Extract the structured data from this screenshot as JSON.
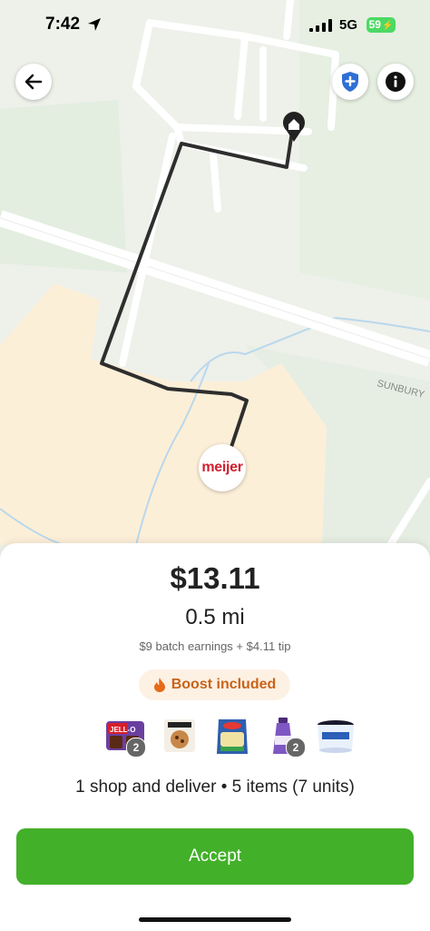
{
  "status_bar": {
    "time": "7:42",
    "network": "5G",
    "battery": "59"
  },
  "map": {
    "store_name": "meijer",
    "road_label": "SUNBURY"
  },
  "offer": {
    "price": "$13.11",
    "distance": "0.5 mi",
    "breakdown": "$9 batch earnings + $4.11 tip",
    "boost_label": "Boost included",
    "items": [
      {
        "name": "jello-pudding-item",
        "count": "2"
      },
      {
        "name": "quest-cookie-item",
        "count": ""
      },
      {
        "name": "kraft-cheese-item",
        "count": ""
      },
      {
        "name": "coffee-creamer-item",
        "count": "2"
      },
      {
        "name": "ice-cream-item",
        "count": ""
      }
    ],
    "summary": "1 shop and deliver • 5 items (7 units)",
    "accept_label": "Accept"
  },
  "colors": {
    "accent": "#43b02a",
    "boost_text": "#c9631a",
    "boost_bg": "#fdf1e4",
    "store_brand": "#d0202f"
  }
}
